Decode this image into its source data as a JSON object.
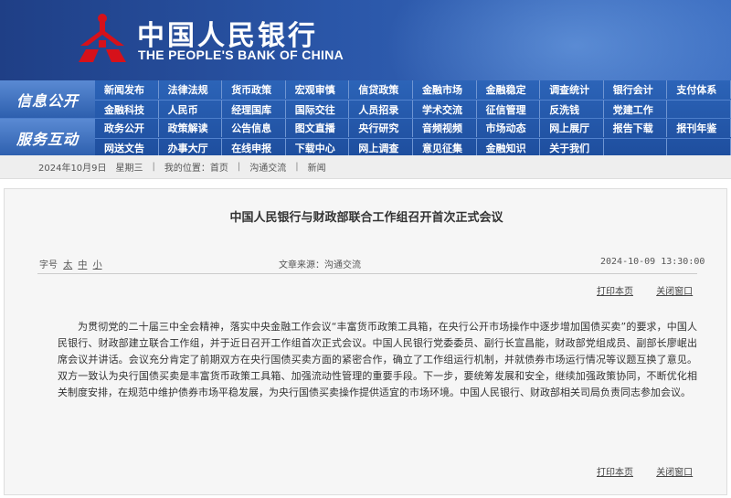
{
  "header": {
    "title_cn": "中国人民银行",
    "title_en": "THE PEOPLE'S BANK OF CHINA",
    "logo_icon": "pboc-emblem-icon",
    "brand_color": "#d6111a",
    "banner_color": "#2a56a8"
  },
  "nav": {
    "groups": [
      {
        "title": "信息公开",
        "row1": [
          "新闻发布",
          "法律法规",
          "货币政策",
          "宏观审慎",
          "信贷政策",
          "金融市场",
          "金融稳定",
          "调查统计",
          "银行会计",
          "支付体系"
        ],
        "row2": [
          "金融科技",
          "人民币",
          "经理国库",
          "国际交往",
          "人员招录",
          "学术交流",
          "征信管理",
          "反洗钱",
          "党建工作",
          ""
        ]
      },
      {
        "title": "服务互动",
        "row1": [
          "政务公开",
          "政策解读",
          "公告信息",
          "图文直播",
          "央行研究",
          "音频视频",
          "市场动态",
          "网上展厅",
          "报告下载",
          "报刊年鉴"
        ],
        "row2": [
          "网送文告",
          "办事大厅",
          "在线申报",
          "下载中心",
          "网上调查",
          "意见征集",
          "金融知识",
          "关于我们",
          "",
          ""
        ]
      }
    ]
  },
  "breadcrumb": {
    "date": "2024年10月9日",
    "weekday": "星期三",
    "location_prefix": "我的位置：",
    "items": [
      "首页",
      "沟通交流",
      "新闻"
    ]
  },
  "article": {
    "title": "中国人民银行与财政部联合工作组召开首次正式会议",
    "font_size_label": "字号",
    "font_sizes": [
      "太",
      "中",
      "小"
    ],
    "source": "文章来源：沟通交流",
    "date": "2024-10-09 13:30:00",
    "print_label": "打印本页",
    "close_label": "关闭窗口",
    "body": "为贯彻党的二十届三中全会精神，落实中央金融工作会议“丰富货币政策工具箱，在央行公开市场操作中逐步增加国债买卖”的要求，中国人民银行、财政部建立联合工作组，并于近日召开工作组首次正式会议。中国人民银行党委委员、副行长宣昌能，财政部党组成员、副部长廖岷出席会议并讲话。会议充分肯定了前期双方在央行国债买卖方面的紧密合作，确立了工作组运行机制，并就债券市场运行情况等议题互换了意见。双方一致认为央行国债买卖是丰富货币政策工具箱、加强流动性管理的重要手段。下一步，要统筹发展和安全，继续加强政策协同，不断优化相关制度安排，在规范中维护债券市场平稳发展，为央行国债买卖操作提供适宜的市场环境。中国人民银行、财政部相关司局负责同志参加会议。"
  }
}
